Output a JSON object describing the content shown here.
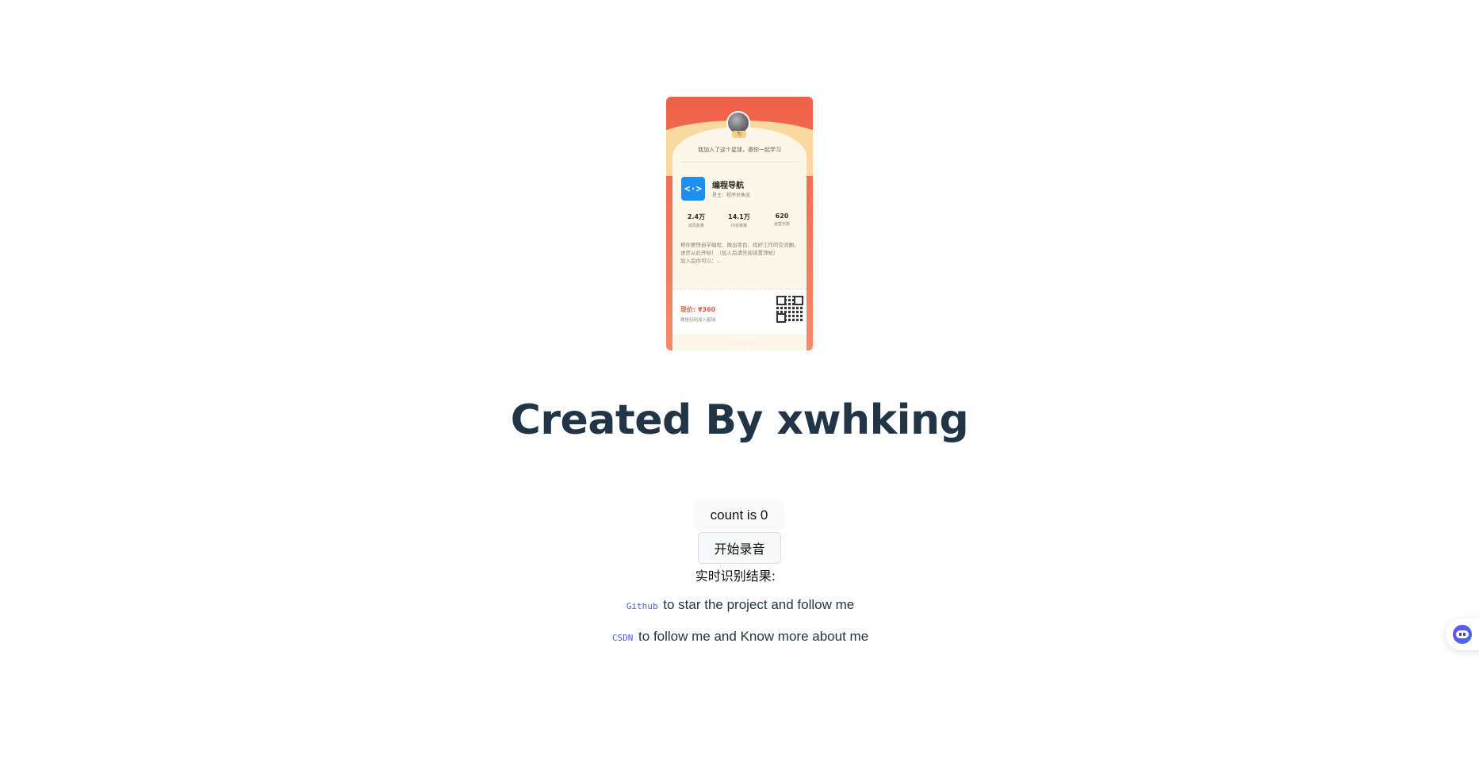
{
  "card": {
    "avatar_tag": "为",
    "invite_text": "我加入了这个星球，邀你一起学习",
    "group_logo_text": "<·>",
    "group_name": "编程导航",
    "group_owner": "星主：程序员鱼皮",
    "stats": [
      {
        "value": "2.4万",
        "label": "成员数量"
      },
      {
        "value": "14.1万",
        "label": "内容数量"
      },
      {
        "value": "620",
        "label": "运营天数"
      }
    ],
    "description_line1": "帮你更快自学编程、做出项目、找好工作的交流圈，进步从此开始！（加入后请先阅读置顶帖）",
    "description_line2": "加入后你可以：...",
    "price": "现价: ¥360",
    "price_sub": "微信扫码加入星球",
    "footer": "◌ 知识星球"
  },
  "main": {
    "title": "Created By xwhking",
    "count_button": "count is 0",
    "record_button": "开始录音",
    "result_label": "实时识别结果:",
    "links": [
      {
        "code": "Github",
        "text": " to star the project and follow me"
      },
      {
        "code": "CSDN",
        "text": " to follow me and Know more about me"
      }
    ]
  },
  "colors": {
    "title": "#213547",
    "link": "#4c5fd5",
    "card_red": "#f0614a",
    "assistant": "#6b4cf6"
  },
  "icons": {
    "assistant": "bot-icon"
  }
}
